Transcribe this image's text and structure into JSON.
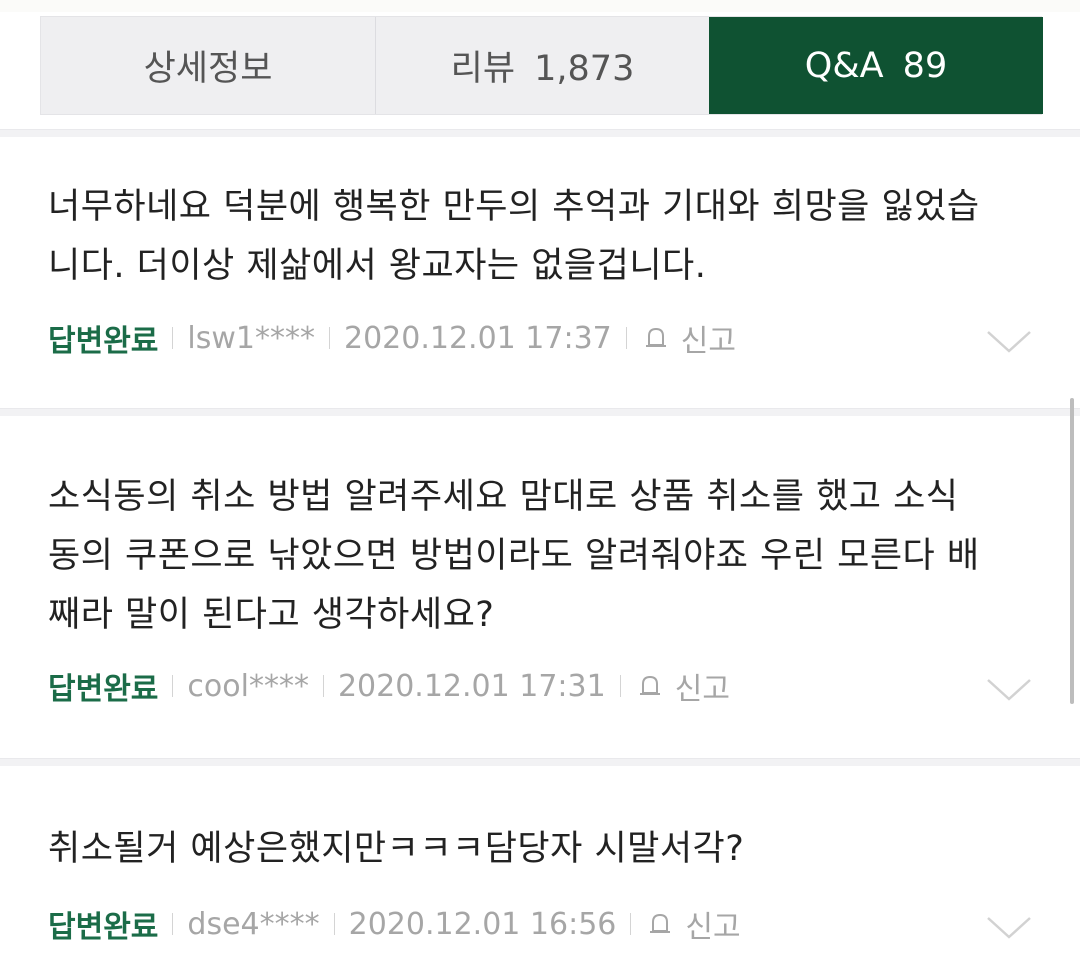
{
  "tabs": [
    {
      "label": "상세정보",
      "active": false
    },
    {
      "label": "리뷰 1,873",
      "active": false
    },
    {
      "label": "Q&A 89",
      "active": true
    }
  ],
  "report_label": "신고",
  "items": [
    {
      "lines": [
        "너무하네요 덕분에 행복한 만두의 추억과 기대와 희망을 잃었습",
        "니다. 더이상 제삶에서 왕교자는 없을겁니다."
      ],
      "status": "답변완료",
      "user": "lsw1****",
      "datetime": "2020.12.01 17:37"
    },
    {
      "lines": [
        "소식동의 취소 방법 알려주세요 맘대로 상품 취소를 했고 소식",
        "동의 쿠폰으로 낚았으면 방법이라도 알려줘야죠 우린 모른다 배",
        "째라 말이 된다고 생각하세요?"
      ],
      "status": "답변완료",
      "user": "cool****",
      "datetime": "2020.12.01 17:31"
    },
    {
      "lines": [
        "취소될거 예상은했지만ㅋㅋㅋ담당자 시말서각?"
      ],
      "status": "답변완료",
      "user": "dse4****",
      "datetime": "2020.12.01 16:56"
    }
  ],
  "colors": {
    "active_tab_bg": "#0f5232",
    "status_green": "#1b6c48",
    "meta_gray": "#a6a6a6"
  },
  "icons": {
    "report": "bell-icon",
    "expand": "chevron-down-icon"
  }
}
